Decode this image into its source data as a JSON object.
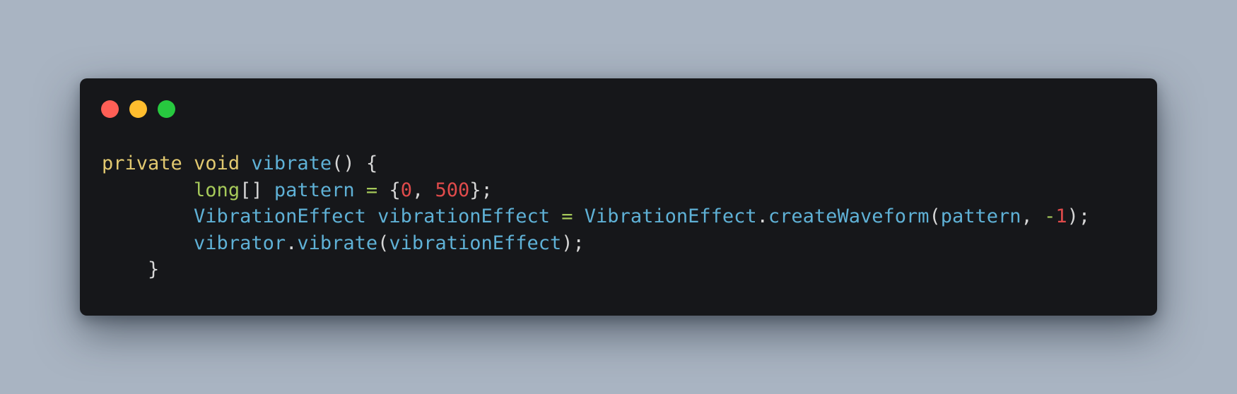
{
  "colors": {
    "background": "#a9b4c2",
    "window": "#16171a",
    "close": "#ff5f56",
    "minimize": "#ffbd2e",
    "maximize": "#27c93f",
    "keyword": "#e2c970",
    "type": "#a6c95a",
    "identifier": "#5fb1d6",
    "number": "#e04b4b",
    "punctuation": "#d6d6d6"
  },
  "window_controls": [
    "close",
    "minimize",
    "maximize"
  ],
  "code": {
    "line1": {
      "kw1": "private",
      "kw2": "void",
      "fn": "vibrate",
      "p1": "()",
      "p2": "{"
    },
    "line2": {
      "type": "long",
      "brackets": "[]",
      "id": "pattern",
      "eq": "=",
      "open": "{",
      "n1": "0",
      "comma": ",",
      "n2": "500",
      "close": "};"
    },
    "line3": {
      "type": "VibrationEffect",
      "id": "vibrationEffect",
      "eq": "=",
      "cls": "VibrationEffect",
      "dot": ".",
      "method": "createWaveform",
      "open": "(",
      "arg": "pattern",
      "comma": ",",
      "minus": "-",
      "n": "1",
      "close": ");"
    },
    "line4": {
      "obj": "vibrator",
      "dot": ".",
      "method": "vibrate",
      "open": "(",
      "arg": "vibrationEffect",
      "close": ");"
    },
    "line5": {
      "brace": "}"
    }
  }
}
